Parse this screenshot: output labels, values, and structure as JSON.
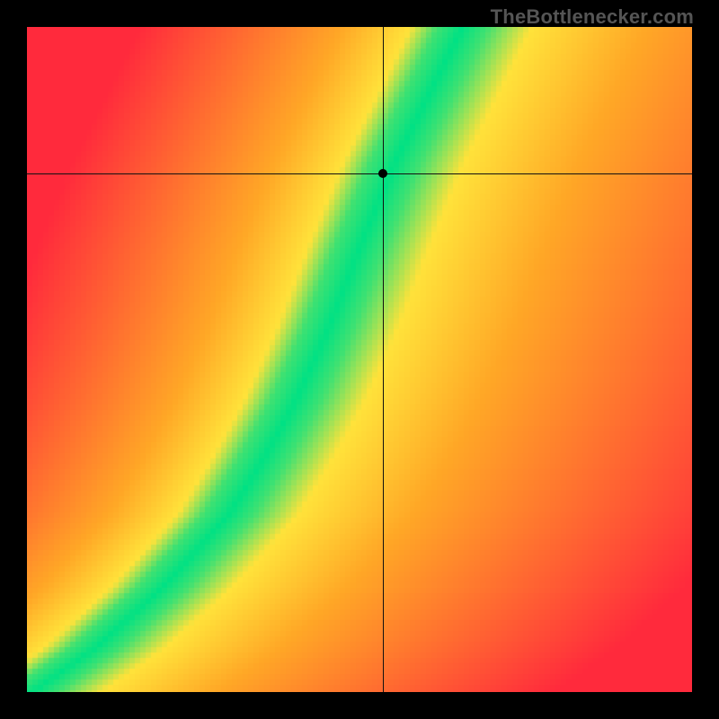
{
  "watermark": "TheBottlenecker.com",
  "chart_data": {
    "type": "heatmap",
    "xlabel": "",
    "ylabel": "",
    "xlim": [
      0,
      1
    ],
    "ylim": [
      0,
      1
    ],
    "crosshair": {
      "x": 0.535,
      "y": 0.78
    },
    "marker": {
      "x": 0.535,
      "y": 0.78
    },
    "ideal_curve": [
      {
        "x": 0.0,
        "y": 0.0
      },
      {
        "x": 0.1,
        "y": 0.07
      },
      {
        "x": 0.2,
        "y": 0.16
      },
      {
        "x": 0.3,
        "y": 0.27
      },
      {
        "x": 0.35,
        "y": 0.35
      },
      {
        "x": 0.4,
        "y": 0.44
      },
      {
        "x": 0.45,
        "y": 0.55
      },
      {
        "x": 0.5,
        "y": 0.68
      },
      {
        "x": 0.55,
        "y": 0.8
      },
      {
        "x": 0.6,
        "y": 0.9
      },
      {
        "x": 0.65,
        "y": 1.0
      }
    ],
    "band_half_width": 0.038,
    "colors": {
      "good": "#00E184",
      "mid": "#FFE23A",
      "warn": "#FFA726",
      "bad": "#FF2A3C"
    },
    "grid": false,
    "legend": false
  }
}
